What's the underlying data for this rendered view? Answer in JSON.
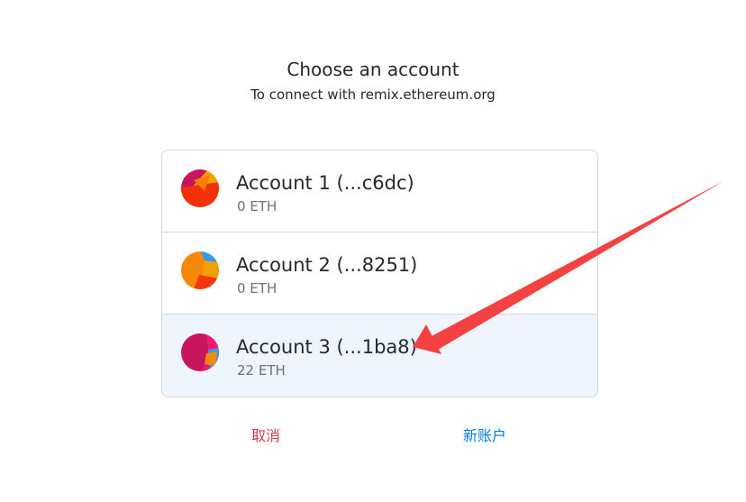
{
  "header": {
    "title": "Choose an account",
    "subtitle": "To connect with remix.ethereum.org"
  },
  "accounts": [
    {
      "name": "Account 1 (...c6dc)",
      "balance": "0 ETH",
      "selected": false
    },
    {
      "name": "Account 2 (...8251)",
      "balance": "0 ETH",
      "selected": false
    },
    {
      "name": "Account 3 (...1ba8)",
      "balance": "22 ETH",
      "selected": true
    }
  ],
  "footer": {
    "cancel_label": "取消",
    "new_account_label": "新账户"
  },
  "colors": {
    "accent_blue": "#037dd6",
    "cancel_red": "#d73a49",
    "selected_bg": "#eef5fc",
    "annotation_arrow": "#f44242"
  },
  "annotation": {
    "type": "arrow",
    "points_to": "account-3"
  }
}
